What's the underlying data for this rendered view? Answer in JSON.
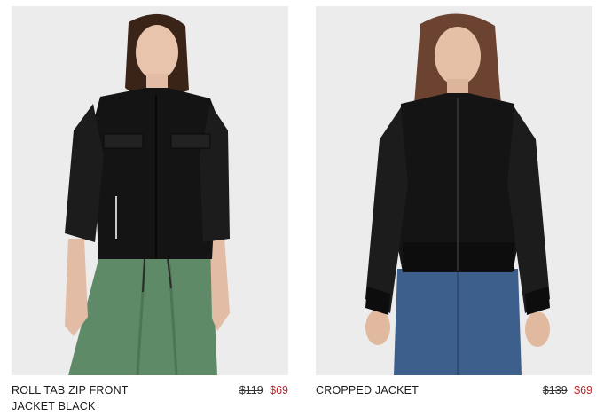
{
  "products": [
    {
      "name_line1": "ROLL TAB ZIP FRONT",
      "name_line2": "JACKET BLACK",
      "original_price": "$119",
      "sale_price": "$69",
      "image_alt": "Model wearing black roll tab zip front jacket with green skirt"
    },
    {
      "name_line1": "CROPPED JACKET",
      "name_line2": "",
      "original_price": "$139",
      "sale_price": "$69",
      "image_alt": "Model wearing black cropped bomber jacket with blue jeans"
    }
  ],
  "colors": {
    "photo_bg": "#ececec",
    "sale_price": "#b3282d",
    "jacket": "#141414",
    "skirt": "#5f8a67",
    "jeans": "#3d5f8c"
  }
}
